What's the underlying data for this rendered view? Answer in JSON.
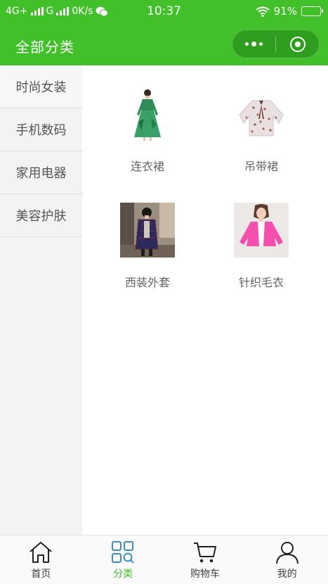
{
  "status_bar": {
    "network": "4G+",
    "network2": "G",
    "speed": "0K/s",
    "time": "10:37",
    "battery": "91%",
    "battery_level": 0.91
  },
  "nav": {
    "title": "全部分类"
  },
  "sidebar": {
    "items": [
      {
        "label": "时尚女装"
      },
      {
        "label": "手机数码"
      },
      {
        "label": "家用电器"
      },
      {
        "label": "美容护肤"
      }
    ]
  },
  "products": [
    {
      "label": "连衣裙",
      "icon": "dress-image"
    },
    {
      "label": "吊带裙",
      "icon": "blouse-image"
    },
    {
      "label": "西装外套",
      "icon": "coat-image"
    },
    {
      "label": "针织毛衣",
      "icon": "cardigan-image"
    }
  ],
  "tabbar": {
    "items": [
      {
        "label": "首页",
        "icon": "home-icon"
      },
      {
        "label": "分类",
        "icon": "category-icon"
      },
      {
        "label": "购物车",
        "icon": "cart-icon"
      },
      {
        "label": "我的",
        "icon": "user-icon"
      }
    ],
    "active_color": "#41c02a"
  },
  "colors": {
    "brand": "#41c02a"
  }
}
